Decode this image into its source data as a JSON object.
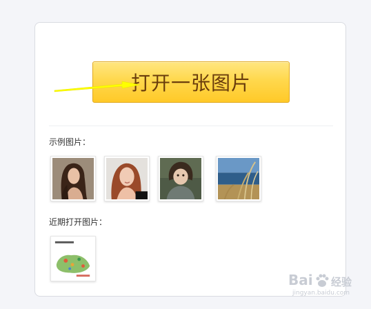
{
  "main": {
    "open_button_label": "打开一张图片",
    "sample_label": "示例图片：",
    "recent_label": "近期打开图片：",
    "sample_images": [
      {
        "name": "sample-portrait-woman-dark-hair"
      },
      {
        "name": "sample-portrait-woman-red-hair"
      },
      {
        "name": "sample-portrait-child"
      },
      {
        "name": "sample-landscape-grass-sea"
      }
    ],
    "recent_images": [
      {
        "name": "recent-map-image"
      }
    ]
  },
  "annotation": {
    "arrow_color": "#ffff00"
  },
  "watermark": {
    "brand": "Bai",
    "suffix": "经验",
    "url": "jingyan.baidu.com"
  },
  "colors": {
    "button_top": "#ffe680",
    "button_bottom": "#ffc928",
    "button_text": "#6a3d0c",
    "page_bg": "#f4f5f9"
  }
}
